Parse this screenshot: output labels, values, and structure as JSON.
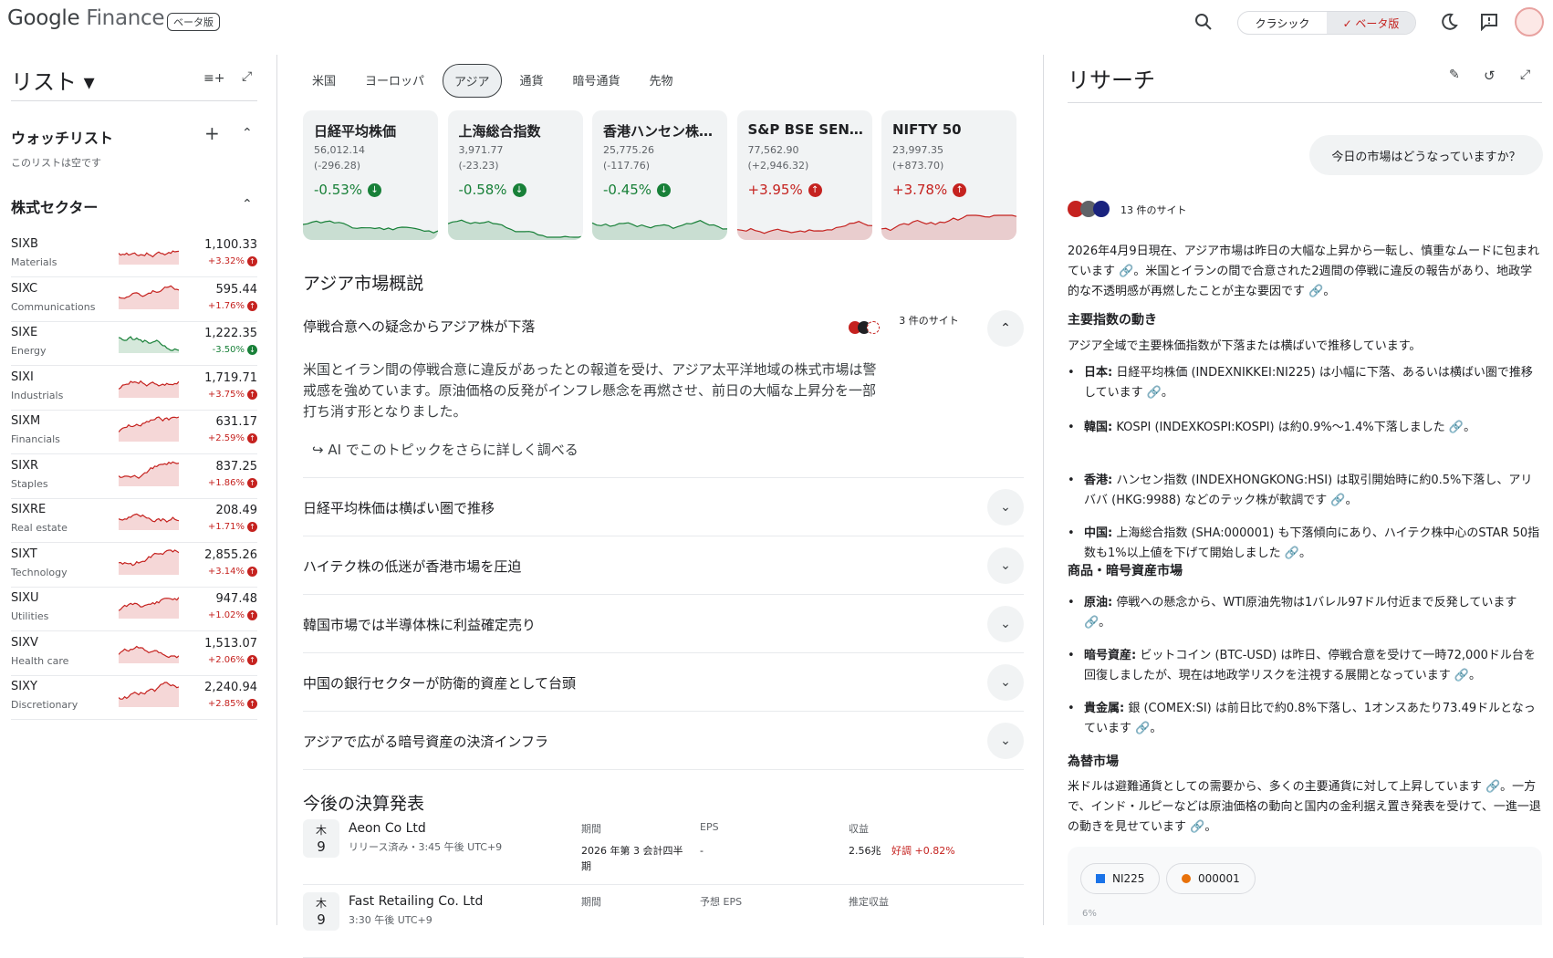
{
  "header": {
    "logo_google": "Google",
    "logo_finance": "Finance",
    "beta_badge": "ベータ版",
    "classic_label": "クラシック",
    "beta_label": "✓ ベータ版"
  },
  "left": {
    "list_title": "リスト ▾",
    "watchlist_title": "ウォッチリスト",
    "watchlist_empty": "このリストは空です",
    "sectors_title": "株式セクター",
    "sectors": [
      {
        "sym": "SIXB",
        "name": "Materials",
        "price": "1,100.33",
        "chg": "+3.32%",
        "up": true
      },
      {
        "sym": "SIXC",
        "name": "Communications",
        "price": "595.44",
        "chg": "+1.76%",
        "up": true
      },
      {
        "sym": "SIXE",
        "name": "Energy",
        "price": "1,222.35",
        "chg": "-3.50%",
        "up": false
      },
      {
        "sym": "SIXI",
        "name": "Industrials",
        "price": "1,719.71",
        "chg": "+3.75%",
        "up": true
      },
      {
        "sym": "SIXM",
        "name": "Financials",
        "price": "631.17",
        "chg": "+2.59%",
        "up": true
      },
      {
        "sym": "SIXR",
        "name": "Staples",
        "price": "837.25",
        "chg": "+1.86%",
        "up": true
      },
      {
        "sym": "SIXRE",
        "name": "Real estate",
        "price": "208.49",
        "chg": "+1.71%",
        "up": true
      },
      {
        "sym": "SIXT",
        "name": "Technology",
        "price": "2,855.26",
        "chg": "+3.14%",
        "up": true
      },
      {
        "sym": "SIXU",
        "name": "Utilities",
        "price": "947.48",
        "chg": "+1.02%",
        "up": true
      },
      {
        "sym": "SIXV",
        "name": "Health care",
        "price": "1,513.07",
        "chg": "+2.06%",
        "up": true
      },
      {
        "sym": "SIXY",
        "name": "Discretionary",
        "price": "2,240.94",
        "chg": "+2.85%",
        "up": true
      }
    ]
  },
  "middle": {
    "tabs": [
      "米国",
      "ヨーロッパ",
      "アジア",
      "通貨",
      "暗号通貨",
      "先物"
    ],
    "cards": [
      {
        "title": "日経平均株価",
        "price": "56,012.14",
        "chg": "(-296.28)",
        "pct": "-0.53%",
        "up": false
      },
      {
        "title": "上海総合指数",
        "price": "3,971.77",
        "chg": "(-23.23)",
        "pct": "-0.58%",
        "up": false
      },
      {
        "title": "香港ハンセン株価指数",
        "price": "25,775.26",
        "chg": "(-117.76)",
        "pct": "-0.45%",
        "up": false
      },
      {
        "title": "S&P BSE SENSEX",
        "price": "77,562.90",
        "chg": "(+2,946.32)",
        "pct": "+3.95%",
        "up": true
      },
      {
        "title": "NIFTY 50",
        "price": "23,997.35",
        "chg": "(+873.70)",
        "pct": "+3.78%",
        "up": true
      }
    ],
    "overview_title": "アジア市場概説",
    "top_topic": "停戦合意への疑念からアジア株が下落",
    "top_sources": "3 件のサイト",
    "top_body": "米国とイラン間の停戦合意に違反があったとの報道を受け、アジア太平洋地域の株式市場は警戒感を強めています。原油価格の反発がインフレ懸念を再燃させ、前日の大幅な上昇分を一部打ち消す形となりました。",
    "ai_more": "AI でこのトピックをさらに詳しく調べる",
    "topics": [
      "日経平均株価は横ばい圏で推移",
      "ハイテク株の低迷が香港市場を圧迫",
      "韓国市場では半導体株に利益確定売り",
      "中国の銀行セクターが防衛的資産として台頭",
      "アジアで広がる暗号資産の決済インフラ"
    ],
    "earnings_title": "今後の決算発表",
    "earnings": [
      {
        "dow": "木",
        "day": "9",
        "company": "Aeon Co Ltd",
        "status": "リリース済み・3:45 午後 UTC+9",
        "h1": "期間",
        "v1": "2026 年第 3 会計四半期",
        "h2": "EPS",
        "v2": "-",
        "h3": "収益",
        "v3": "2.56兆",
        "v3b": "好調 +0.82%"
      },
      {
        "dow": "木",
        "day": "9",
        "company": "Fast Retailing Co. Ltd",
        "status": "3:30 午後 UTC+9",
        "h1": "期間",
        "v1": "",
        "h2": "予想 EPS",
        "v2": "",
        "h3": "推定収益",
        "v3": "",
        "v3b": ""
      }
    ]
  },
  "research": {
    "title": "リサーチ",
    "question": "今日の市場はどうなっていますか？",
    "sources": "13 件のサイト",
    "intro": "2026年4月9日現在、アジア市場は昨日の大幅な上昇から一転し、慎重なムードに包まれています 🔗。米国とイランの間で合意された2週間の停戦に違反の報告があり、地政学的な不透明感が再燃したことが主な要因です 🔗。",
    "h1": "主要指数の動き",
    "p1": "アジア全域で主要株価指数が下落または横ばいで推移しています。",
    "b1": [
      {
        "k": "日本:",
        "t": " 日経平均株価 (INDEXNIKKEI:NI225) は小幅に下落、あるいは横ばい圏で推移しています 🔗。"
      },
      {
        "k": "韓国:",
        "t": " KOSPI (INDEXKOSPI:KOSPI) は約0.9%〜1.4%下落しました 🔗。"
      },
      {
        "k": "香港:",
        "t": " ハンセン指数 (INDEXHONGKONG:HSI) は取引開始時に約0.5%下落し、アリババ (HKG:9988) などのテック株が軟調です 🔗。"
      },
      {
        "k": "中国:",
        "t": " 上海総合指数 (SHA:000001) も下落傾向にあり、ハイテク株中心のSTAR 50指数も1%以上値を下げて開始しました 🔗。"
      }
    ],
    "h2": "商品・暗号資産市場",
    "b2": [
      {
        "k": "原油:",
        "t": " 停戦への懸念から、WTI原油先物は1バレル97ドル付近まで反発しています 🔗。"
      },
      {
        "k": "暗号資産:",
        "t": " ビットコイン (BTC-USD) は昨日、停戦合意を受けて一時72,000ドル台を回復しましたが、現在は地政学リスクを注視する展開となっています 🔗。"
      },
      {
        "k": "貴金属:",
        "t": " 銀 (COMEX:SI) は前日比で約0.8%下落し、1オンスあたり73.49ドルとなっています 🔗。"
      }
    ],
    "h3": "為替市場",
    "p3": "米ドルは避難通貨としての需要から、多くの主要通貨に対して上昇しています 🔗。一方で、インド・ルピーなどは原油価格の動向と国内の金利据え置き発表を受けて、一進一退の動きを見せています 🔗。",
    "chip1": "NI225",
    "chip2": "000001",
    "chart_tick": "6%"
  },
  "colors": {
    "up": "#c5221f",
    "down": "#188038"
  }
}
